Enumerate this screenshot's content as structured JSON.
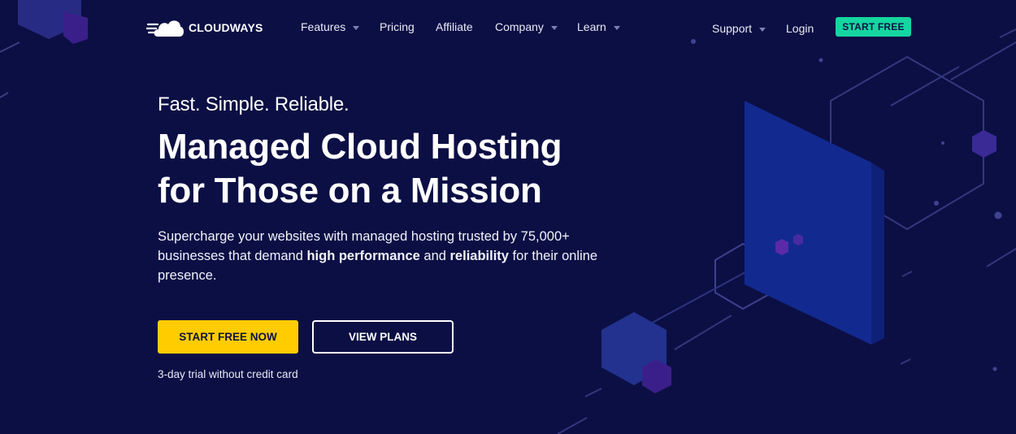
{
  "brand": {
    "name": "CLOUDWAYS",
    "logo_icon": "cloud-icon"
  },
  "nav": {
    "features": "Features",
    "pricing": "Pricing",
    "affiliate": "Affiliate",
    "company": "Company",
    "learn": "Learn",
    "support": "Support",
    "login": "Login",
    "start_free": "START FREE"
  },
  "hero": {
    "kicker": "Fast. Simple. Reliable.",
    "headline_line1": "Managed Cloud Hosting",
    "headline_line2": "for Those on a Mission",
    "desc_part1": "Supercharge your websites with managed hosting trusted by 75,000+ businesses that demand ",
    "desc_bold1": "high performance",
    "desc_part2": " and ",
    "desc_bold2": "reliability",
    "desc_part3": " for their online presence.",
    "primary_cta": "START FREE NOW",
    "secondary_cta": "VIEW PLANS",
    "trial_note": "3-day trial without credit card"
  },
  "colors": {
    "background": "#0c0f44",
    "accent_green": "#15d6a0",
    "accent_yellow": "#ffcc00",
    "text": "#ffffff"
  }
}
